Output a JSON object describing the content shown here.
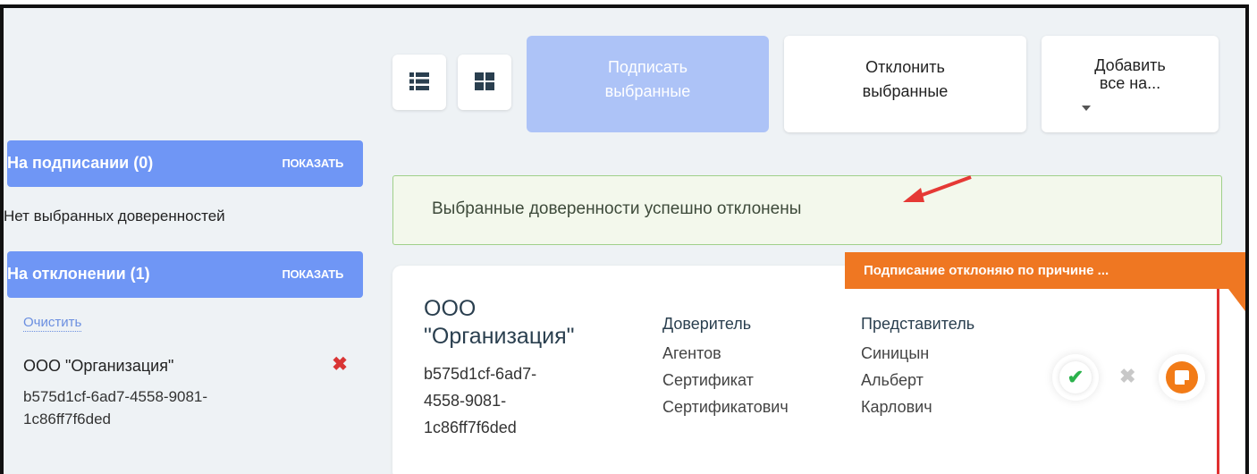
{
  "sidebar": {
    "signing": {
      "title": "На подписании (0)",
      "show_label": "ПОКАЗАТЬ"
    },
    "empty_text": "Нет выбранных доверенностей",
    "rejecting": {
      "title": "На отклонении (1)",
      "show_label": "ПОКАЗАТЬ"
    },
    "clear_label": "Очистить",
    "items": [
      {
        "title": "ООО \"Организация\"",
        "id": "b575d1cf-6ad7-4558-9081-1c86ff7f6ded",
        "remove_icon": "✖"
      }
    ]
  },
  "toolbar": {
    "list_view_icon": "list-view-icon",
    "grid_view_icon": "grid-view-icon",
    "sign_selected": [
      "Подписать",
      "выбранные"
    ],
    "reject_selected": [
      "Отклонить",
      "выбранные"
    ],
    "add_all": [
      "Добавить",
      "все на..."
    ]
  },
  "alert": {
    "message": "Выбранные доверенности успешно отклонены"
  },
  "card": {
    "org": [
      "ООО",
      "\"Организация\""
    ],
    "id_lines": [
      "b575d1cf-6ad7-",
      "4558-9081-",
      "1c86ff7f6ded"
    ],
    "principal": {
      "label": "Доверитель",
      "lines": [
        "Агентов",
        "Сертификат",
        "Сертификатович"
      ]
    },
    "representative": {
      "label": "Представитель",
      "lines": [
        "Синицын",
        "Альберт",
        "Карлович"
      ]
    },
    "reject_banner": "Подписание отклоняю по причине ...",
    "approve_icon": "✔",
    "cancel_icon": "✖"
  },
  "colors": {
    "accent": "#6f96f5",
    "accent_light": "#adc3f7",
    "orange": "#ef7722",
    "success_border": "#9fd08a",
    "danger": "#e03030"
  }
}
